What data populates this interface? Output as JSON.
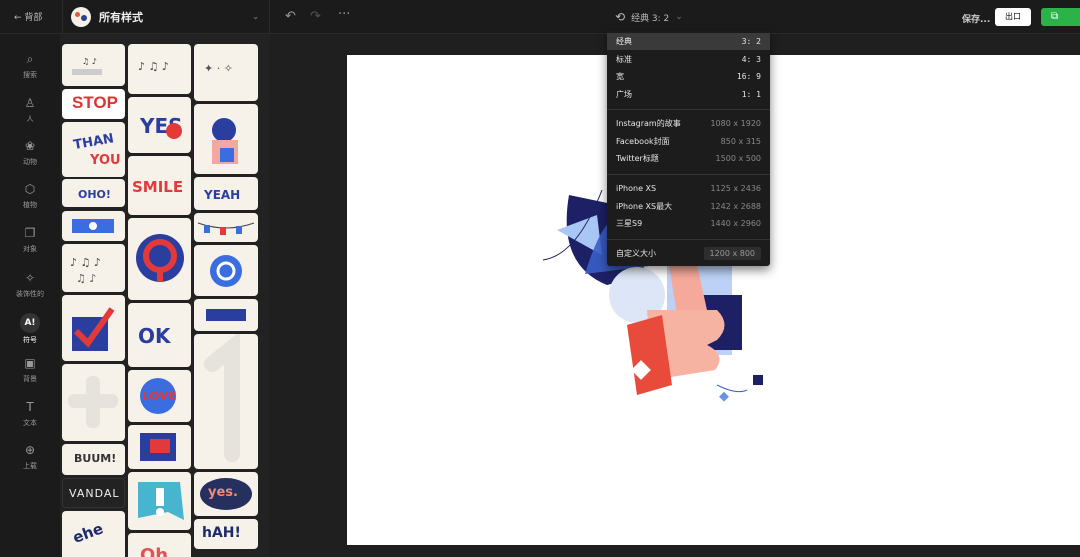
{
  "topbar": {
    "back_label": "← 背部",
    "collection_title": "所有样式",
    "undo_icon": "undo-icon",
    "redo_icon": "redo-icon",
    "more_icon": "more-icon",
    "size_label": "经典 3: 2",
    "saving_label": "保存...",
    "export_label": "出口",
    "share_label": "",
    "accent": "#2bb34a"
  },
  "nav": [
    {
      "icon": "search-icon",
      "glyph": "⌕",
      "label": "搜索"
    },
    {
      "icon": "person-icon",
      "glyph": "♙",
      "label": "人"
    },
    {
      "icon": "paw-icon",
      "glyph": "❀",
      "label": "动物"
    },
    {
      "icon": "object-icon",
      "glyph": "⬡",
      "label": "植物"
    },
    {
      "icon": "copy-icon",
      "glyph": "❐",
      "label": "对象"
    },
    {
      "icon": "sparkle-icon",
      "glyph": "✧",
      "label": "装饰性的"
    },
    {
      "icon": "symbol-icon",
      "glyph": "A!",
      "label": "符号"
    },
    {
      "icon": "image-icon",
      "glyph": "▣",
      "label": "背景"
    },
    {
      "icon": "text-icon",
      "glyph": "T",
      "label": "文本"
    },
    {
      "icon": "upload-icon",
      "glyph": "⊕",
      "label": "上载"
    }
  ],
  "panel": {
    "stop_text": "STOP",
    "yes_text": "yes.",
    "hah_text": "hAH!",
    "vandal_text": "VANDAL",
    "boom_text": "BUUM!",
    "smile_text": "SMILE"
  },
  "dropdown": {
    "ratios": [
      {
        "label": "经典",
        "value": "3: 2"
      },
      {
        "label": "标准",
        "value": "4: 3"
      },
      {
        "label": "宽",
        "value": "16: 9"
      },
      {
        "label": "广场",
        "value": "1: 1"
      }
    ],
    "social": [
      {
        "label": "Instagram的故事",
        "value": "1080 x 1920"
      },
      {
        "label": "Facebook封面",
        "value": "850 x 315"
      },
      {
        "label": "Twitter标题",
        "value": "1500 x 500"
      }
    ],
    "phones": [
      {
        "label": "iPhone XS",
        "value": "1125 x 2436"
      },
      {
        "label": "iPhone XS最大",
        "value": "1242 x 2688"
      },
      {
        "label": "三星S9",
        "value": "1440 x 2960"
      }
    ],
    "custom_label": "自定义大小",
    "custom_value": "1200 x 800"
  }
}
